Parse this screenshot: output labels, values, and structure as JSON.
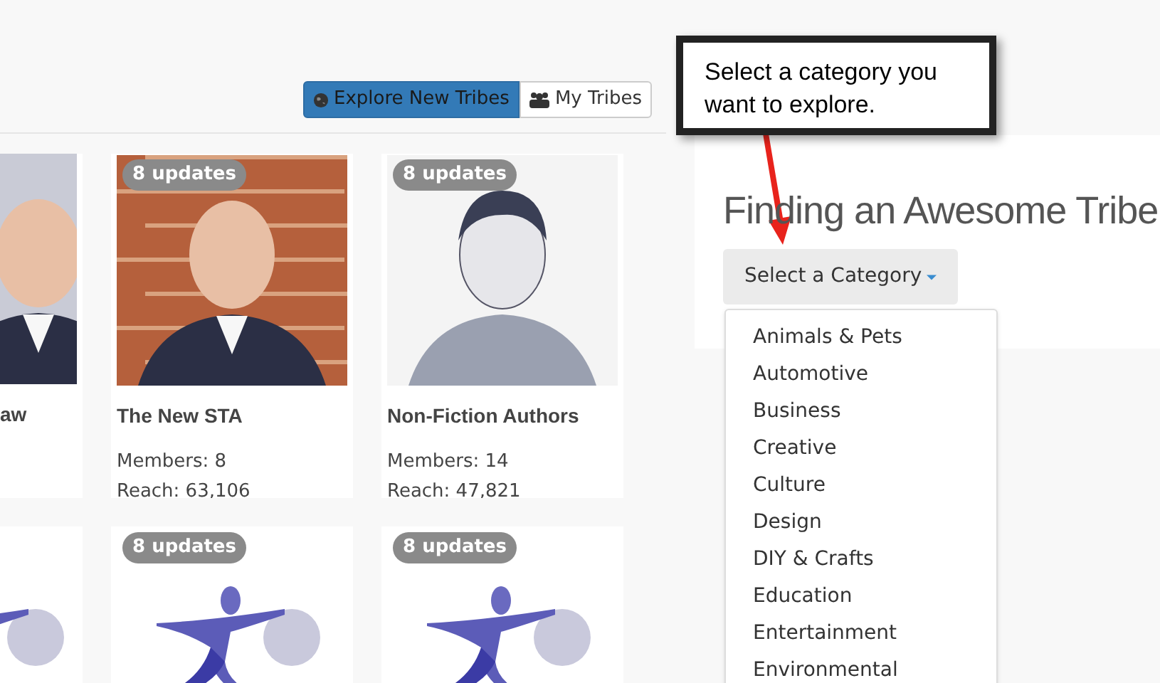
{
  "tabs": [
    {
      "label": "Explore New Tribes",
      "kind": "globe",
      "selected": true
    },
    {
      "label": "My Tribes",
      "kind": "group",
      "selected": false
    }
  ],
  "tribe_cards": [
    {
      "title": "aw",
      "cut": true
    },
    {
      "cut": false,
      "badge": "8 updates",
      "title": "The New STA",
      "members": "Members: 8",
      "reach": "Reach: 63,106"
    },
    {
      "cut": false,
      "badge": "8 updates",
      "title": "Non-Fiction Authors",
      "members": "Members: 14",
      "reach": "Reach: 47,821"
    }
  ],
  "logo_cards": [
    {
      "cut": true
    },
    {
      "cut": false,
      "badge": "8 updates"
    },
    {
      "cut": false,
      "badge": "8 updates"
    }
  ],
  "callout": {
    "text": "Select a category you want to explore."
  },
  "panel": {
    "heading": "Finding an Awesome Tribe",
    "dropdown_button": "Select a Category",
    "dropdown_items": [
      "Animals & Pets",
      "Automotive",
      "Business",
      "Creative",
      "Culture",
      "Design",
      "DIY & Crafts",
      "Education",
      "Entertainment",
      "Environmental"
    ]
  }
}
